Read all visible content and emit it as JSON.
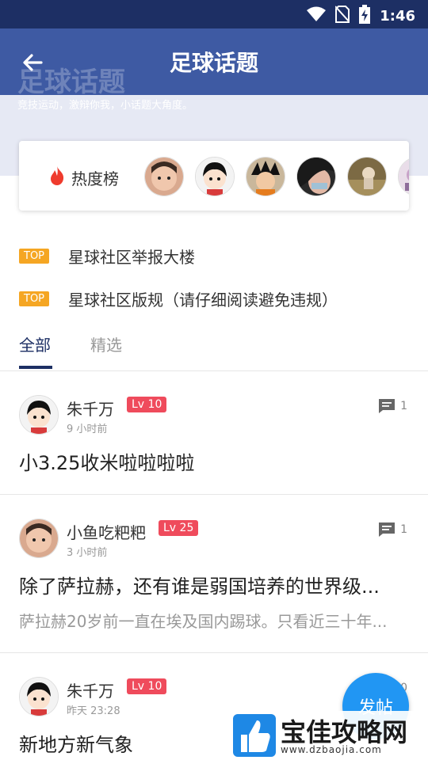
{
  "status_bar": {
    "time": "1:46"
  },
  "header": {
    "title": "足球话题"
  },
  "banner": {
    "ghost_title": "足球话题",
    "subtitle": "竞技运动，激辩你我，小话题大角度。"
  },
  "hot": {
    "label": "热度榜"
  },
  "top_items": [
    {
      "badge": "TOP",
      "text": "星球社区举报大楼"
    },
    {
      "badge": "TOP",
      "text": "星球社区版规（请仔细阅读避免违规）"
    }
  ],
  "tabs": [
    {
      "label": "全部"
    },
    {
      "label": "精选"
    }
  ],
  "posts": [
    {
      "author": "朱千万",
      "level": "Lv 10",
      "time": "9 小时前",
      "comments": "1",
      "title": "小3.25收米啦啦啦啦",
      "excerpt": ""
    },
    {
      "author": "小鱼吃粑粑",
      "level": "Lv 25",
      "time": "3 小时前",
      "comments": "1",
      "title": "除了萨拉赫，还有谁是弱国培养的世界级...",
      "excerpt": "萨拉赫20岁前一直在埃及国内踢球。只看近三十年..."
    },
    {
      "author": "朱千万",
      "level": "Lv 10",
      "time": "昨天 23:28",
      "comments": "0",
      "title": "新地方新气象",
      "excerpt": ""
    }
  ],
  "fab": {
    "label": "发帖"
  },
  "watermark": {
    "title": "宝佳攻略网",
    "url": "www.dzbaojia.com"
  },
  "colors": {
    "status_bar": "#1d2f64",
    "app_bar": "#3e5aa3",
    "accent": "#1d2f64",
    "top_badge": "#f5a623",
    "level_badge": "#ef4b5c",
    "fab": "#2196f3"
  }
}
